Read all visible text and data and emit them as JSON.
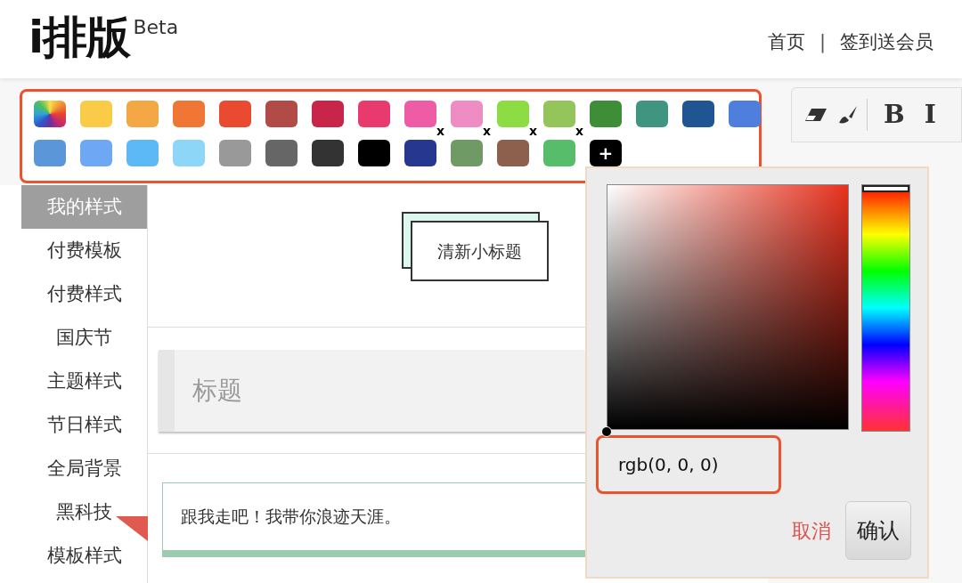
{
  "header": {
    "logo": "i排版",
    "logo_badge": "Beta",
    "nav": [
      {
        "label": "首页"
      },
      {
        "label": "签到送会员"
      }
    ],
    "separator": "|"
  },
  "palette": {
    "swatches": [
      {
        "kind": "rainbow"
      },
      {
        "kind": "preset",
        "color": "#f9cb46"
      },
      {
        "kind": "preset",
        "color": "#f3a845"
      },
      {
        "kind": "preset",
        "color": "#ef7634"
      },
      {
        "kind": "preset",
        "color": "#ea4a2f"
      },
      {
        "kind": "preset",
        "color": "#b04b46"
      },
      {
        "kind": "preset",
        "color": "#c7254a"
      },
      {
        "kind": "preset",
        "color": "#e83a6c"
      },
      {
        "kind": "preset",
        "color": "#ee5ca6"
      },
      {
        "kind": "preset",
        "color": "#f08cc4"
      },
      {
        "kind": "preset",
        "color": "#8ddc44"
      },
      {
        "kind": "preset",
        "color": "#94c55a"
      },
      {
        "kind": "preset",
        "color": "#3d8e37"
      },
      {
        "kind": "preset",
        "color": "#3f9580"
      },
      {
        "kind": "preset",
        "color": "#1f5593"
      },
      {
        "kind": "preset",
        "color": "#4f7fdc"
      },
      {
        "kind": "preset",
        "color": "#5b97d8"
      },
      {
        "kind": "preset",
        "color": "#6ea8f5"
      },
      {
        "kind": "preset",
        "color": "#5cb9f6"
      },
      {
        "kind": "preset",
        "color": "#8ed6f8"
      },
      {
        "kind": "preset",
        "color": "#999999"
      },
      {
        "kind": "preset",
        "color": "#666666"
      },
      {
        "kind": "preset",
        "color": "#333333"
      },
      {
        "kind": "preset",
        "color": "#000000"
      },
      {
        "kind": "custom",
        "color": "#25378f",
        "remove": "x"
      },
      {
        "kind": "custom",
        "color": "#6f9a65",
        "remove": "x"
      },
      {
        "kind": "custom",
        "color": "#8c604c",
        "remove": "x"
      },
      {
        "kind": "custom",
        "color": "#57bd6b",
        "remove": "x"
      },
      {
        "kind": "add",
        "label": "+"
      }
    ]
  },
  "sidebar": {
    "items": [
      {
        "label": "我的样式",
        "selected": true
      },
      {
        "label": "付费模板",
        "selected": false
      },
      {
        "label": "付费样式",
        "selected": false
      },
      {
        "label": "国庆节",
        "selected": false
      },
      {
        "label": "主题样式",
        "selected": false
      },
      {
        "label": "节日样式",
        "selected": false
      },
      {
        "label": "全局背景",
        "selected": false
      },
      {
        "label": "黑科技",
        "selected": false
      },
      {
        "label": "模板样式",
        "selected": false
      }
    ]
  },
  "content": {
    "cards": [
      {
        "kind": "stacked-title",
        "text": "清新小标题"
      },
      {
        "kind": "gray-title",
        "text": "标题"
      },
      {
        "kind": "quote",
        "text": "跟我走吧！我带你浪迹天涯。"
      }
    ]
  },
  "toolbar": {
    "buttons": [
      {
        "kind": "eraser"
      },
      {
        "kind": "brush"
      },
      {
        "kind": "text",
        "label": "B"
      },
      {
        "kind": "text",
        "label": "I"
      }
    ]
  },
  "color_picker": {
    "hue": {
      "level": 0
    },
    "value": "rgb(0, 0, 0)",
    "cancel": "取消",
    "confirm": "确认"
  }
}
